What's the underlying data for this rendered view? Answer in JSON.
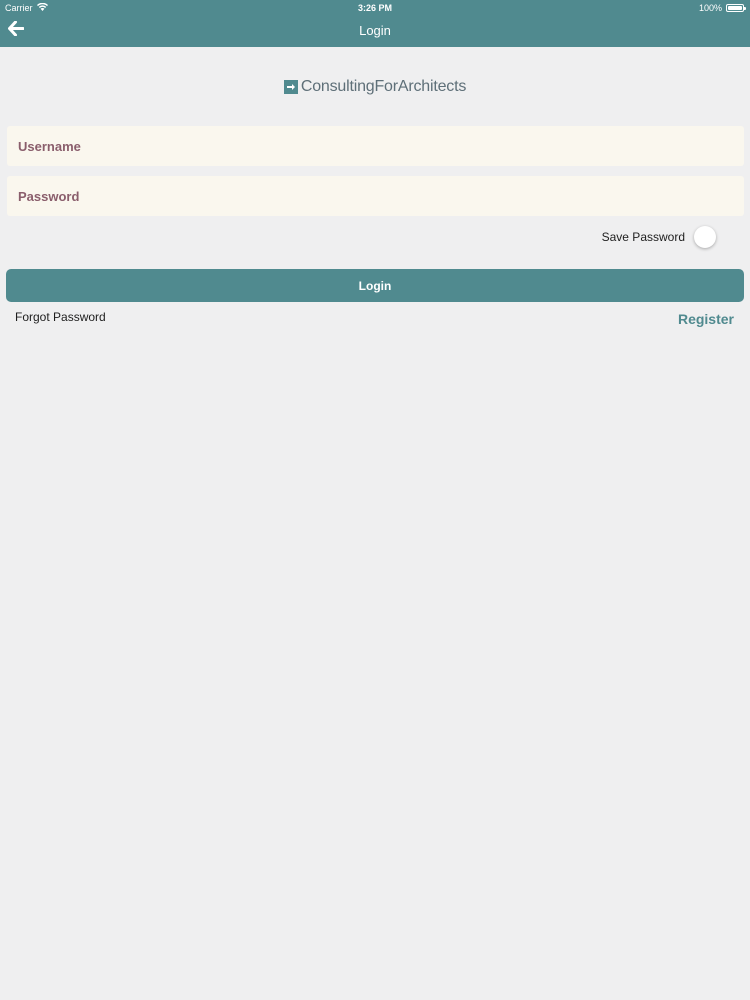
{
  "status_bar": {
    "carrier": "Carrier",
    "time": "3:26 PM",
    "battery": "100%"
  },
  "nav": {
    "title": "Login",
    "back_icon": "arrow-left-icon"
  },
  "logo": {
    "text_part1": "Consulting",
    "text_part2": "For",
    "text_part3": "Architects"
  },
  "form": {
    "username_placeholder": "Username",
    "password_placeholder": "Password",
    "save_password_label": "Save Password",
    "save_password_on": false,
    "login_label": "Login",
    "forgot_label": "Forgot Password",
    "register_label": "Register"
  },
  "colors": {
    "accent": "#508a8f",
    "background": "#efeff0",
    "field_bg": "#faf7ee",
    "placeholder": "#8a5e6c"
  }
}
